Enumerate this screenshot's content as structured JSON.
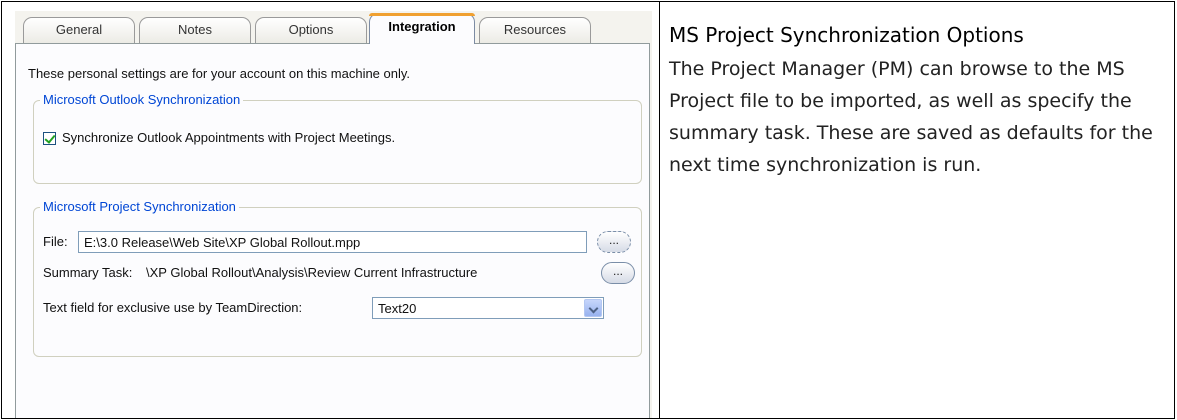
{
  "tabs": [
    {
      "label": "General"
    },
    {
      "label": "Notes"
    },
    {
      "label": "Options"
    },
    {
      "label": "Integration",
      "active": true
    },
    {
      "label": "Resources"
    }
  ],
  "intro": "These personal settings are for your account on this machine only.",
  "outlook_group": {
    "title": "Microsoft Outlook Synchronization",
    "checkbox_label": "Synchronize Outlook Appointments with Project Meetings.",
    "checked": true
  },
  "project_group": {
    "title": "Microsoft Project Synchronization",
    "file_label": "File:",
    "file_value": "E:\\3.0 Release\\Web Site\\XP Global Rollout.mpp",
    "browse_label": "...",
    "summary_label": "Summary Task:",
    "summary_value": "\\XP Global Rollout\\Analysis\\Review Current Infrastructure",
    "text_field_label": "Text field for exclusive use by TeamDirection:",
    "text_field_value": "Text20"
  },
  "description": {
    "title": "MS Project Synchronization Options",
    "body": "The Project Manager (PM) can browse to the MS Project file to be imported, as well as specify the summary task. These are saved as defaults for the next time synchronization is run."
  },
  "colors": {
    "group_title": "#0046d5",
    "active_tab_highlight": "#f0a030",
    "check": "#21a121"
  }
}
